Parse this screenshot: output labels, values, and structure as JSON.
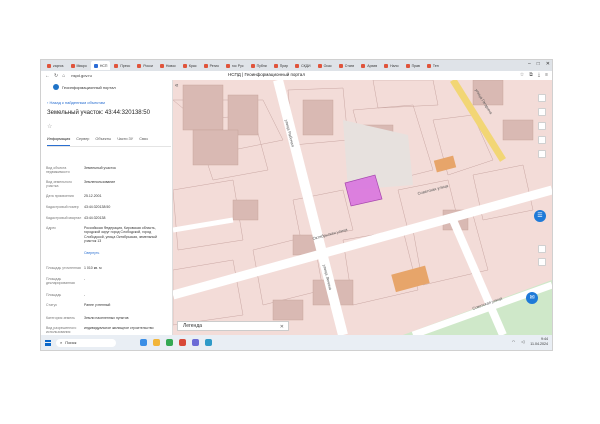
{
  "browser": {
    "tabs": [
      {
        "label": "zapros"
      },
      {
        "label": "Микро"
      },
      {
        "label": "НСП",
        "active": true
      },
      {
        "label": "Пресс"
      },
      {
        "label": "Росси"
      },
      {
        "label": "Новос"
      },
      {
        "label": "Крас"
      },
      {
        "label": "Регио"
      },
      {
        "label": "гос Рус"
      },
      {
        "label": "Публи"
      },
      {
        "label": "Прир"
      },
      {
        "label": "СКДИ"
      },
      {
        "label": "Осас"
      },
      {
        "label": "Стати"
      },
      {
        "label": "Архив"
      },
      {
        "label": "Нало"
      },
      {
        "label": "Прав"
      },
      {
        "label": "Тен"
      }
    ],
    "url": "nspd.gov.ru",
    "page_title": "НСПД | Геоинформационный портал"
  },
  "panel": {
    "brand": "Геоинформационный портал",
    "back_link": "Назад к найденным объектам",
    "parcel_title": "Земельный участок: 43:44:320138:50",
    "tabs": [
      "Информация",
      "Сервер",
      "Объекты",
      "Части ЗУ",
      "Связ"
    ],
    "attributes": [
      {
        "label": "Вид объекта недвижимости",
        "value": "Земельный участок"
      },
      {
        "label": "Вид земельного участка",
        "value": "Землепользование"
      },
      {
        "label": "Дата присвоения",
        "value": "25.12.2001"
      },
      {
        "label": "Кадастровый номер",
        "value": "43:44:320138:50"
      },
      {
        "label": "Кадастровый квартал",
        "value": "43:44:320138"
      },
      {
        "label": "Адрес",
        "value": "Российская Федерация, Кировская область, городской округ город Слободской, город Слободской, улица Октябрьская, земельный участок 13"
      },
      {
        "label": "",
        "value": "Свернуть",
        "link": true
      },
      {
        "label": "Площадь уточненная",
        "value": "1 010 кв. м"
      },
      {
        "label": "Площадь декларированная",
        "value": "-"
      },
      {
        "label": "Площадь",
        "value": "-"
      },
      {
        "label": "Статус",
        "value": "Ранее учтенный"
      },
      {
        "label": "Категория земель",
        "value": "Земли населенных пунктов"
      },
      {
        "label": "Вид разрешенного использования",
        "value": "индивидуальное жилищное строительство"
      }
    ]
  },
  "map": {
    "legend_label": "Легенда",
    "streets": [
      "Октябрьская улица",
      "Советская улица",
      "улица Рабочая",
      "улица Ленина",
      "улица Гагарина",
      "Советская улица"
    ],
    "colors": {
      "background": "#f3dcd8",
      "road": "#ffffff",
      "highlight": "#d86fe0",
      "yellow_road": "#f2d675",
      "parcel_line": "#c9a7a3",
      "building": "#d9b9b3",
      "orange": "#e7a56a",
      "green": "#cfe8c9"
    }
  },
  "taskbar": {
    "search_placeholder": "Поиск",
    "time": "9:44",
    "date": "11.04.2024"
  }
}
